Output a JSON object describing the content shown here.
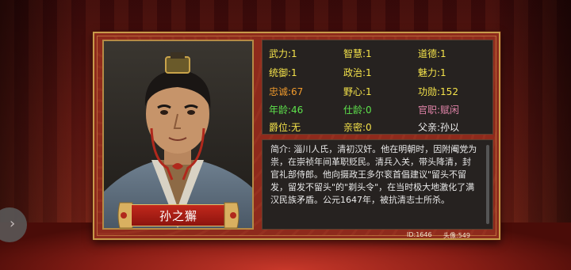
{
  "character": {
    "name": "孙之獬",
    "stats": {
      "wuli": "武力:1",
      "zhihui": "智慧:1",
      "daode": "道德:1",
      "tongyu": "统御:1",
      "zhengzhi": "政治:1",
      "meili": "魅力:1",
      "zhongcheng": "忠诚:67",
      "yexin": "野心:1",
      "gongxun": "功勋:152",
      "nianling": "年龄:46",
      "shiling": "仕龄:0",
      "guanzhi": "官职:赋闲",
      "juewei": "爵位:无",
      "qinmi": "亲密:0",
      "fuqin": "父亲:孙以"
    },
    "bio": "简介: 淄川人氏，清初汉奸。他在明朝时，因附阉党为祟，在崇祯年间革职贬民。清兵入关，带头降清，封官礼部侍郎。他向摄政王多尔衮首倡建议\"留头不留发，留发不留头\"的\"剃头令\"，在当时极大地激化了满汉民族矛盾。公元1647年，被抗清志士所杀。",
    "id": "ID:1646",
    "portrait_no": "头像:549"
  },
  "colors": {
    "primary_stat": "#f4e24a",
    "loyalty": "#f09a2c",
    "age": "#5ee24c",
    "office": "#e084a8",
    "panel": "#8e2a1c",
    "frame_gold": "#c79a4a"
  },
  "icons": {
    "side_handle": "back-handle-icon"
  }
}
